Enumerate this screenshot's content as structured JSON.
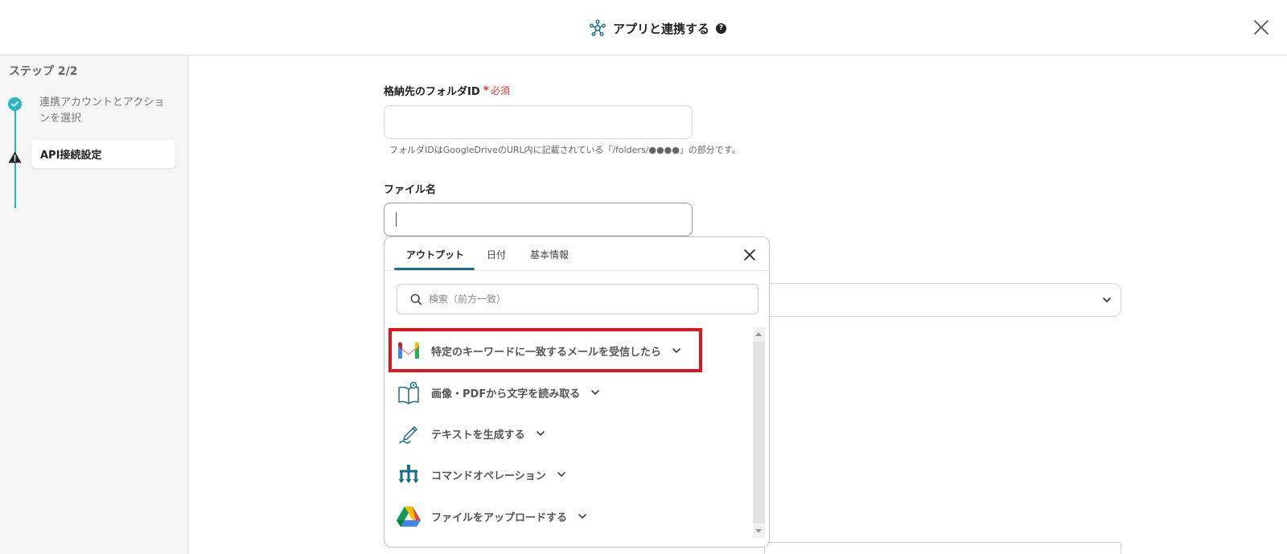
{
  "header": {
    "title": "アプリと連携する",
    "help_glyph": "?",
    "close_icon": "close-icon"
  },
  "sidebar": {
    "step_label": "ステップ 2/2",
    "steps": [
      {
        "label": "連携アカウントとアクションを選択",
        "status": "done"
      },
      {
        "label": "API接続設定",
        "status": "warning"
      }
    ]
  },
  "form": {
    "folder_id": {
      "label": "格納先のフォルダID",
      "required_mark": "*",
      "required_text": "必須",
      "value": "",
      "hint": "フォルダIDはGoogleDriveのURL内に記載されている「/folders/●●●●」の部分です。"
    },
    "file_name": {
      "label": "ファイル名",
      "value": ""
    }
  },
  "popup": {
    "tabs": [
      "アウトプット",
      "日付",
      "基本情報"
    ],
    "active_tab": 0,
    "search_placeholder": "検索（前方一致）",
    "items": [
      {
        "label": "特定のキーワードに一致するメールを受信したら",
        "icon": "gmail-icon",
        "highlighted": true
      },
      {
        "label": "画像・PDFから文字を読み取る",
        "icon": "ocr-book-icon"
      },
      {
        "label": "テキストを生成する",
        "icon": "pen-icon"
      },
      {
        "label": "コマンドオペレーション",
        "icon": "command-operation-icon"
      },
      {
        "label": "ファイルをアップロードする",
        "icon": "google-drive-icon"
      }
    ]
  },
  "colors": {
    "accent": "#2bb5c4",
    "tab_underline": "#1b6e86",
    "required": "#e53935",
    "highlight": "#e0141b"
  }
}
